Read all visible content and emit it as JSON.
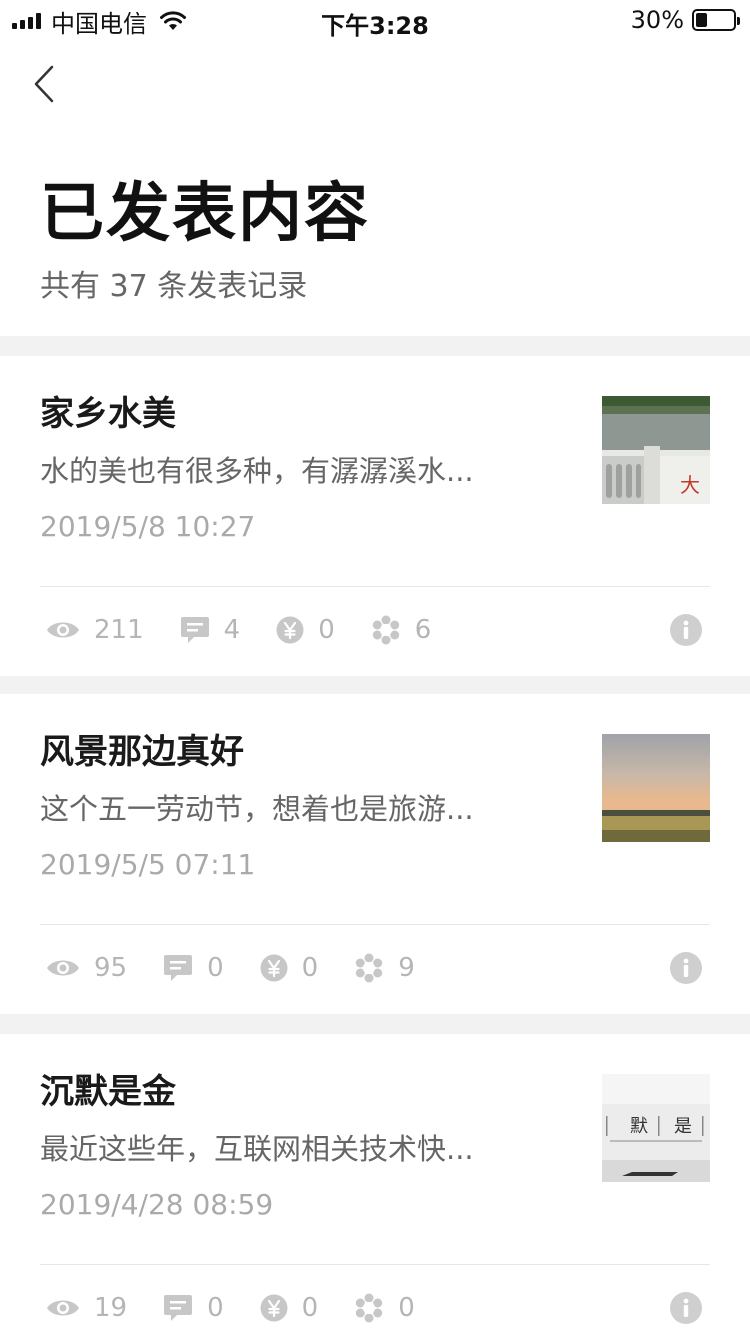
{
  "status_bar": {
    "carrier": "中国电信",
    "time": "下午3:28",
    "battery": "30%",
    "battery_level": 0.3
  },
  "header": {
    "title": "已发表内容",
    "subtitle": "共有 37 条发表记录"
  },
  "icons": {
    "back": "chevron-left-icon",
    "views": "eye-icon",
    "comments": "comment-icon",
    "rewards": "yen-icon",
    "likes": "flower-icon",
    "info": "info-icon"
  },
  "colors": {
    "divider_band": "#f2f2f2",
    "stat_icon": "#c7c7c7",
    "stat_text": "#b5b5b5"
  },
  "posts": [
    {
      "title": "家乡水美",
      "excerpt": "水的美也有很多种，有潺潺溪水...",
      "date": "2019/5/8  10:27",
      "thumbnail": "river-railing-photo",
      "views": "211",
      "comments": "4",
      "rewards": "0",
      "likes": "6"
    },
    {
      "title": "风景那边真好",
      "excerpt": "这个五一劳动节，想着也是旅游...",
      "date": "2019/5/5  07:11",
      "thumbnail": "sunset-field-photo",
      "views": "95",
      "comments": "0",
      "rewards": "0",
      "likes": "9"
    },
    {
      "title": "沉默是金",
      "excerpt": "最近这些年，互联网相关技术快...",
      "date": "2019/4/28  08:59",
      "thumbnail": "silence-text-photo",
      "views": "19",
      "comments": "0",
      "rewards": "0",
      "likes": "0"
    }
  ],
  "thumbnail_texts": {
    "river_sign": "大",
    "silence_sign_1": "默",
    "silence_sign_2": "是"
  }
}
